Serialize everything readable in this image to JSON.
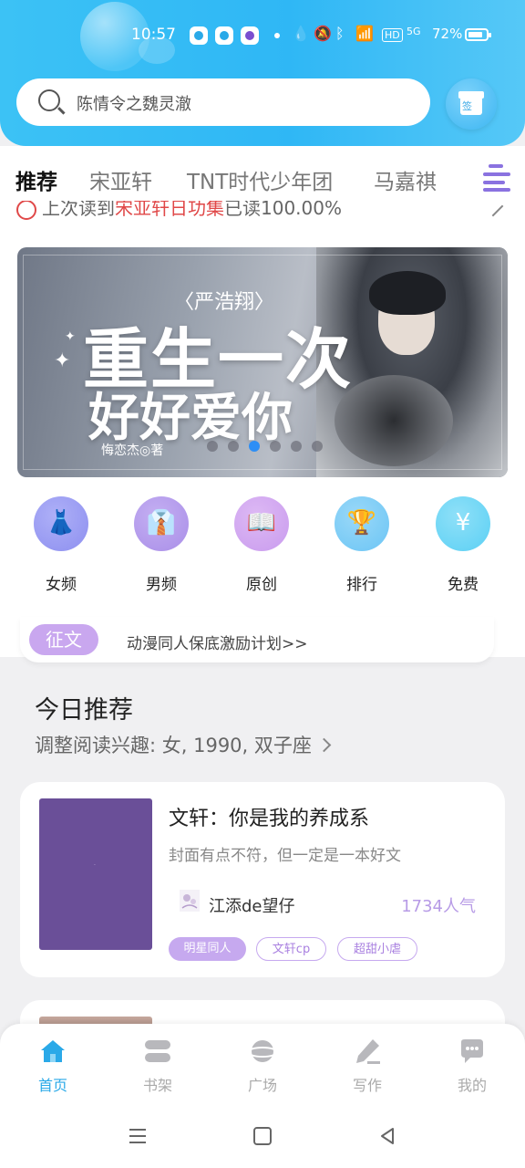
{
  "status_bar": {
    "time": "10:57",
    "battery_percent": "72%",
    "network_label": "5G",
    "hd_label": "HD"
  },
  "search": {
    "placeholder": "陈情令之魏灵澈",
    "sign_label": "签"
  },
  "tabs": [
    {
      "label": "推荐",
      "active": true
    },
    {
      "label": "宋亚轩",
      "active": false
    },
    {
      "label": "TNT时代少年团",
      "active": false
    },
    {
      "label": "马嘉祺",
      "active": false
    }
  ],
  "last_read": {
    "prefix": "上次读到",
    "book": "宋亚轩日功集",
    "suffix": "已读100.00%"
  },
  "banner": {
    "subtitle": "〈严浩翔〉",
    "title_line1": "重生一次",
    "title_line2": "好好爱你",
    "author": "悔恋杰◎著",
    "dot_count": 6,
    "active_dot": 2
  },
  "categories": [
    {
      "label": "女频",
      "icon": "dress-icon",
      "color": "#8d8ff0"
    },
    {
      "label": "男频",
      "icon": "shirt-icon",
      "color": "#a98ee8"
    },
    {
      "label": "原创",
      "icon": "book-icon",
      "color": "#c99bee"
    },
    {
      "label": "排行",
      "icon": "trophy-icon",
      "color": "#6bc5f5"
    },
    {
      "label": "免费",
      "icon": "yen-icon",
      "color": "#5bd0f4"
    }
  ],
  "notice": {
    "tag": "征文",
    "text": "动漫同人保底激励计划>>"
  },
  "section": {
    "title": "今日推荐",
    "subtitle": "调整阅读兴趣: 女, 1990, 双子座"
  },
  "book_card": {
    "title": "文轩：你是我的养成系",
    "description": "封面有点不符，但一定是一本好文",
    "author": "江添de望仔",
    "popularity": "1734人气",
    "cover_color": "#6a4f98",
    "tags": [
      "明星同人",
      "文轩cp",
      "超甜小虐"
    ]
  },
  "bottom_nav": [
    {
      "label": "首页",
      "icon": "home-icon",
      "active": true
    },
    {
      "label": "书架",
      "icon": "bookshelf-icon",
      "active": false
    },
    {
      "label": "广场",
      "icon": "planet-icon",
      "active": false
    },
    {
      "label": "写作",
      "icon": "pen-icon",
      "active": false
    },
    {
      "label": "我的",
      "icon": "chat-icon",
      "active": false
    }
  ],
  "colors": {
    "accent": "#2aa9e8",
    "header_gradient_start": "#3cc2f5",
    "purple_tag": "#c6a9ef",
    "highlight_red": "#e04848"
  }
}
